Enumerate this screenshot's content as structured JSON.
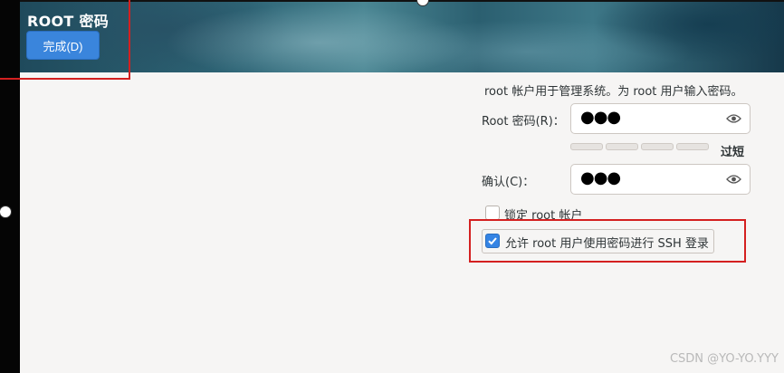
{
  "header": {
    "title": "ROOT 密码",
    "done_label": "完成(D)"
  },
  "form": {
    "description": "root 帐户用于管理系统。为 root 用户输入密码。",
    "password_label": "Root 密码(R)：",
    "password_value": "●●●",
    "strength_label": "过短",
    "confirm_label": "确认(C)：",
    "confirm_value": "●●●",
    "lock_root_label": "锁定 root 帐户",
    "lock_root_checked": false,
    "allow_ssh_label": "允许 root 用户使用密码进行 SSH 登录",
    "allow_ssh_checked": true
  },
  "icons": {
    "reveal_password": "eye-icon",
    "checkmark": "check-icon"
  },
  "colors": {
    "accent": "#3584e4",
    "annotation_red": "#d42020",
    "done_button": "#3a85dc"
  },
  "watermark": "CSDN @YO-YO.YYY"
}
